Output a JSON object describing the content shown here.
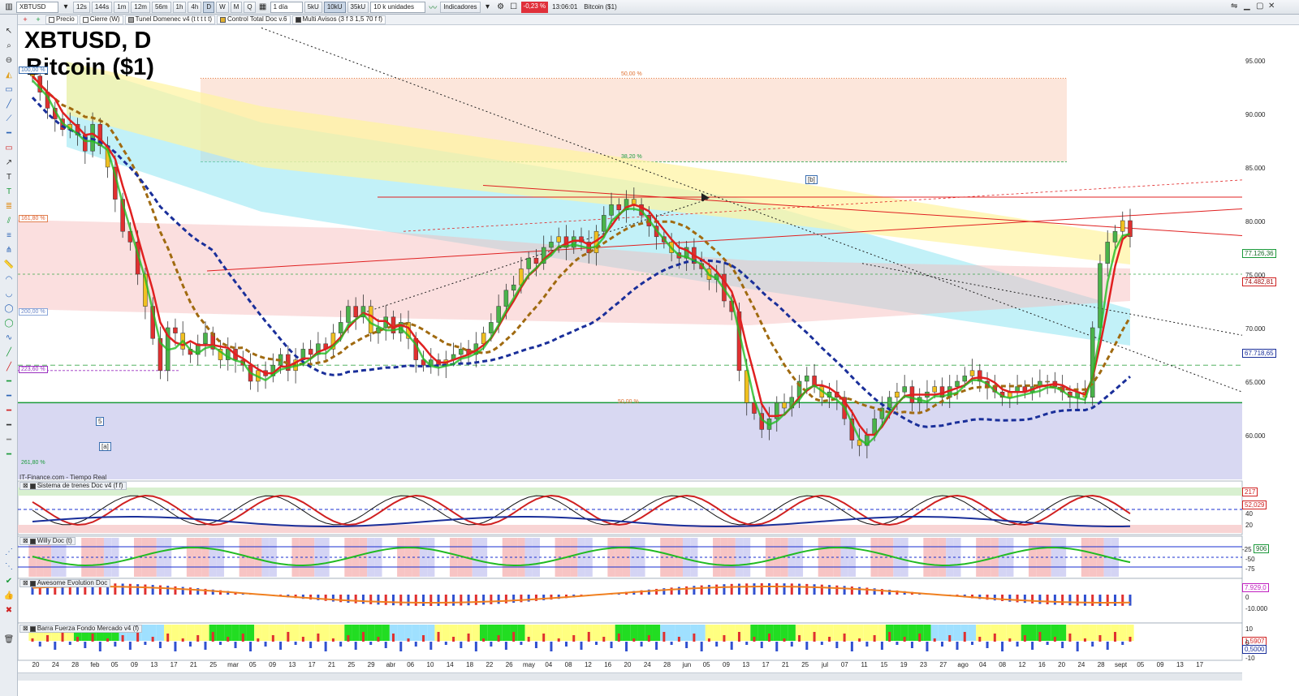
{
  "toolbar": {
    "symbol": "XBTUSD",
    "timeframes": [
      "12s",
      "144s",
      "1m",
      "12m",
      "56m",
      "1h",
      "4h",
      "D",
      "W",
      "M",
      "Q"
    ],
    "active_timeframe": "D",
    "period": "1 día",
    "tick_units": [
      "5kU",
      "10kU",
      "35kU"
    ],
    "active_tick": "10kU",
    "units_select": "10 k unidades",
    "indicators_label": "Indicadores",
    "change": "-0,23 %",
    "time": "13:06:01",
    "instrument": "Bitcoin ($1)",
    "colors": {
      "change_bg": "#e0303a",
      "toolbar_bg": "#e5e9ee"
    }
  },
  "toolbar2": {
    "items": [
      "Precio",
      "Cierre (W)",
      "Tunel Domenec v4 (t t t t t)",
      "Control Total Doc v.6",
      "Multi Avisos (3 f 3 1,5 70 f f)"
    ]
  },
  "chart": {
    "title": "XBTUSD, D",
    "subtitle": "Bitcoin ($1)",
    "source": "IT-Finance.com - Tiempo Real",
    "y_axis_labels": [
      "95.000",
      "90.000",
      "85.000",
      "80.000",
      "75.000",
      "70.000",
      "65.000",
      "60.000"
    ],
    "price_tags": [
      {
        "label": "77.126,36",
        "color": "#1a9a3a"
      },
      {
        "label": "74.482,81",
        "color": "#d02020"
      },
      {
        "label": "67.718,65",
        "color": "#1a2f9a"
      }
    ],
    "fib_tags_left": [
      "100,00 %",
      "161,80 %",
      "200,00 %",
      "223,60 %",
      "261,80 %"
    ],
    "fib_tags_mid": [
      "50,00 %",
      "38,20 %",
      "50,00 %"
    ],
    "wave_labels": [
      "[b]",
      "5",
      "[a]"
    ]
  },
  "indicators": [
    {
      "title": "Sistema de trenes Doc v4 (f f)",
      "tags": [
        "217",
        "52,029"
      ],
      "axis": [
        "40",
        "20"
      ]
    },
    {
      "title": "Willy Doc (t)",
      "tags": [
        "906"
      ],
      "axis": [
        "-25",
        "-50",
        "-75"
      ]
    },
    {
      "title": "Awesome Evolution Doc",
      "tags": [
        "7.929,0"
      ],
      "axis": [
        "0",
        "-10.000"
      ]
    },
    {
      "title": "Barra Fuerza Fondo Mercado v4 (f)",
      "tags": [
        "1,5907",
        "0,5000"
      ],
      "axis": [
        "10",
        "0",
        "-10"
      ]
    }
  ],
  "x_axis": [
    "20",
    "24",
    "28",
    "feb",
    "05",
    "09",
    "13",
    "17",
    "21",
    "25",
    "mar",
    "05",
    "09",
    "13",
    "17",
    "21",
    "25",
    "29",
    "abr",
    "06",
    "10",
    "14",
    "18",
    "22",
    "26",
    "may",
    "04",
    "08",
    "12",
    "16",
    "20",
    "24",
    "28",
    "jun",
    "05",
    "09",
    "13",
    "17",
    "21",
    "25",
    "jul",
    "07",
    "11",
    "15",
    "19",
    "23",
    "27",
    "ago",
    "04",
    "08",
    "12",
    "16",
    "20",
    "24",
    "28",
    "sept",
    "05",
    "09",
    "13",
    "17"
  ],
  "chart_data": {
    "type": "candlestick",
    "title": "XBTUSD, D",
    "subtitle": "Bitcoin ($1)",
    "ylim": [
      56000,
      98000
    ],
    "closes": [
      93500,
      92000,
      90500,
      89500,
      88500,
      89000,
      88000,
      86500,
      89000,
      87000,
      85000,
      82000,
      79000,
      78000,
      75000,
      72000,
      69000,
      66000,
      70000,
      69500,
      68000,
      67500,
      68500,
      69500,
      68000,
      67000,
      68000,
      67000,
      66500,
      65000,
      66000,
      65500,
      66500,
      67500,
      66000,
      67000,
      68000,
      67500,
      68500,
      68000,
      69500,
      70500,
      72000,
      71000,
      72000,
      69500,
      70000,
      71000,
      69500,
      70500,
      69000,
      67000,
      66500,
      67000,
      66500,
      67000,
      67500,
      68000,
      67500,
      68500,
      69500,
      70500,
      72000,
      73500,
      74000,
      75500,
      76500,
      76000,
      77500,
      78000,
      78500,
      77500,
      78500,
      78000,
      77000,
      79000,
      80500,
      81500,
      81000,
      82000,
      81500,
      80500,
      79500,
      78500,
      78000,
      77000,
      76500,
      77500,
      76000,
      75500,
      74500,
      75000,
      72500,
      71500,
      66000,
      63000,
      62000,
      60500,
      61500,
      63000,
      62500,
      63500,
      65000,
      65500,
      64500,
      63500,
      64000,
      63500,
      61500,
      59500,
      59000,
      60000,
      61500,
      62500,
      63500,
      64000,
      64500,
      63000,
      63500,
      64000,
      64500,
      63500,
      64500,
      65000,
      65500,
      66000,
      65000,
      64500,
      64000,
      63500,
      64000,
      64500,
      64000,
      64500,
      65000,
      65000,
      64500,
      64000,
      63500,
      64000,
      63500,
      70000,
      76000,
      78000,
      79000,
      80000,
      78500
    ]
  }
}
